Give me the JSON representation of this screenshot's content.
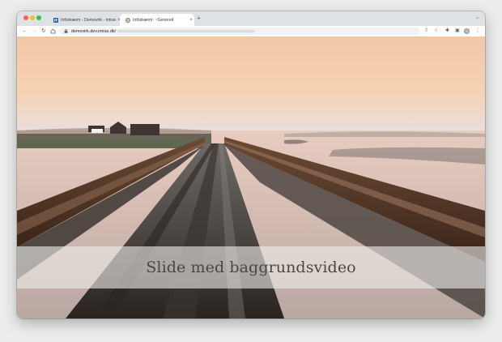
{
  "browser": {
    "tabs": [
      {
        "title": "Infoskærm - Demovirk - Intras",
        "active": false,
        "favicon": "intras-favicon-icon"
      },
      {
        "title": "Infoskærm: ~Generelt",
        "active": true,
        "favicon": "globe-favicon-icon"
      }
    ],
    "url_host": "demovirk.dev.intras.dk/",
    "colors": {
      "tabstrip": "#dee1e6",
      "active_tab": "#ffffff"
    }
  },
  "slide": {
    "caption": "Slide med baggrundsvideo",
    "background": "pier-at-sunset-video"
  }
}
